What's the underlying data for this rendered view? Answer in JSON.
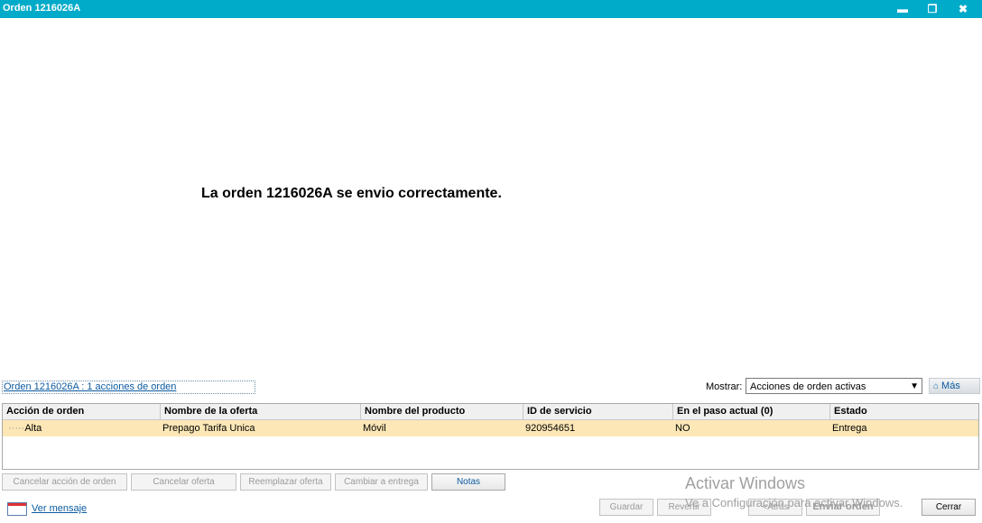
{
  "window": {
    "title": "Orden 1216026A",
    "minimize_glyph": "▬",
    "restore_glyph": "❐",
    "close_glyph": "✖"
  },
  "main": {
    "message": "La orden 1216026A se envio correctamente."
  },
  "summary": {
    "order_link": "Orden 1216026A : 1 acciones de orden",
    "mostrar_label": "Mostrar:",
    "mostrar_value": "Acciones de orden activas",
    "mas_label": "Más"
  },
  "table": {
    "headers": [
      "Acción de orden",
      "Nombre de la oferta",
      "Nombre del producto",
      "ID de servicio",
      "En el paso actual (0)",
      "Estado"
    ],
    "rows": [
      [
        "Alta",
        "Prepago Tarifa Unica",
        "Móvil",
        "920954651",
        "NO",
        "Entrega"
      ]
    ]
  },
  "actions": {
    "cancel_action": "Cancelar acción de orden",
    "cancel_offer": "Cancelar oferta",
    "replace_offer": "Reemplazar oferta",
    "change_delivery": "Cambiar a entrega",
    "notes": "Notas"
  },
  "footer": {
    "ver_mensaje": "Ver mensaje",
    "guardar": "Guardar",
    "revertir": "Revertir",
    "atras": "<Atrás",
    "enviar": "Enviar orden",
    "cerrar": "Cerrar"
  },
  "watermark": {
    "line1": "Activar Windows",
    "line2": "Ve a Configuración para activar Windows."
  }
}
